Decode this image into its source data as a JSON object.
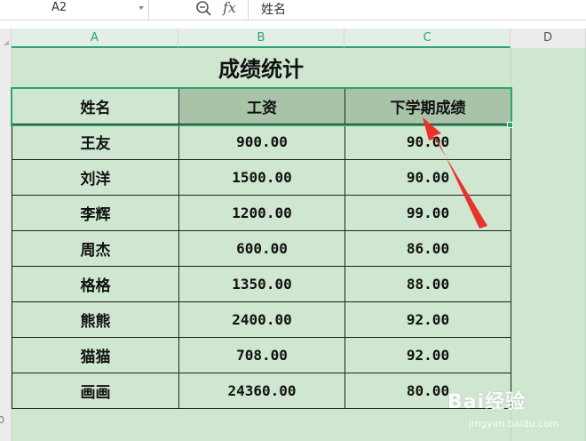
{
  "formula_bar": {
    "cell_ref": "A2",
    "content": "姓名",
    "fx_label": "fx"
  },
  "columns": [
    {
      "label": "A",
      "selected": true
    },
    {
      "label": "B",
      "selected": true
    },
    {
      "label": "C",
      "selected": true
    },
    {
      "label": "D",
      "selected": false
    }
  ],
  "row_numbers_visible": [
    "0"
  ],
  "sheet": {
    "title": "成绩统计",
    "headers": [
      "姓名",
      "工资",
      "下学期成绩"
    ],
    "rows": [
      [
        "王友",
        "900.00",
        "90.00"
      ],
      [
        "刘洋",
        "1500.00",
        "90.00"
      ],
      [
        "李辉",
        "1200.00",
        "99.00"
      ],
      [
        "周杰",
        "600.00",
        "86.00"
      ],
      [
        "格格",
        "1350.00",
        "88.00"
      ],
      [
        "熊熊",
        "2400.00",
        "92.00"
      ],
      [
        "猫猫",
        "708.00",
        "92.00"
      ],
      [
        "画画",
        "24360.00",
        "80.00"
      ]
    ]
  },
  "watermark": {
    "brand": "Bai经验",
    "url": "jingyan.baidu.com"
  },
  "colors": {
    "accent": "#2fa56c",
    "sheet_bg": "#cfe6d0",
    "header_shade": "#a8c3a8",
    "annotation_arrow": "#e8322a"
  }
}
